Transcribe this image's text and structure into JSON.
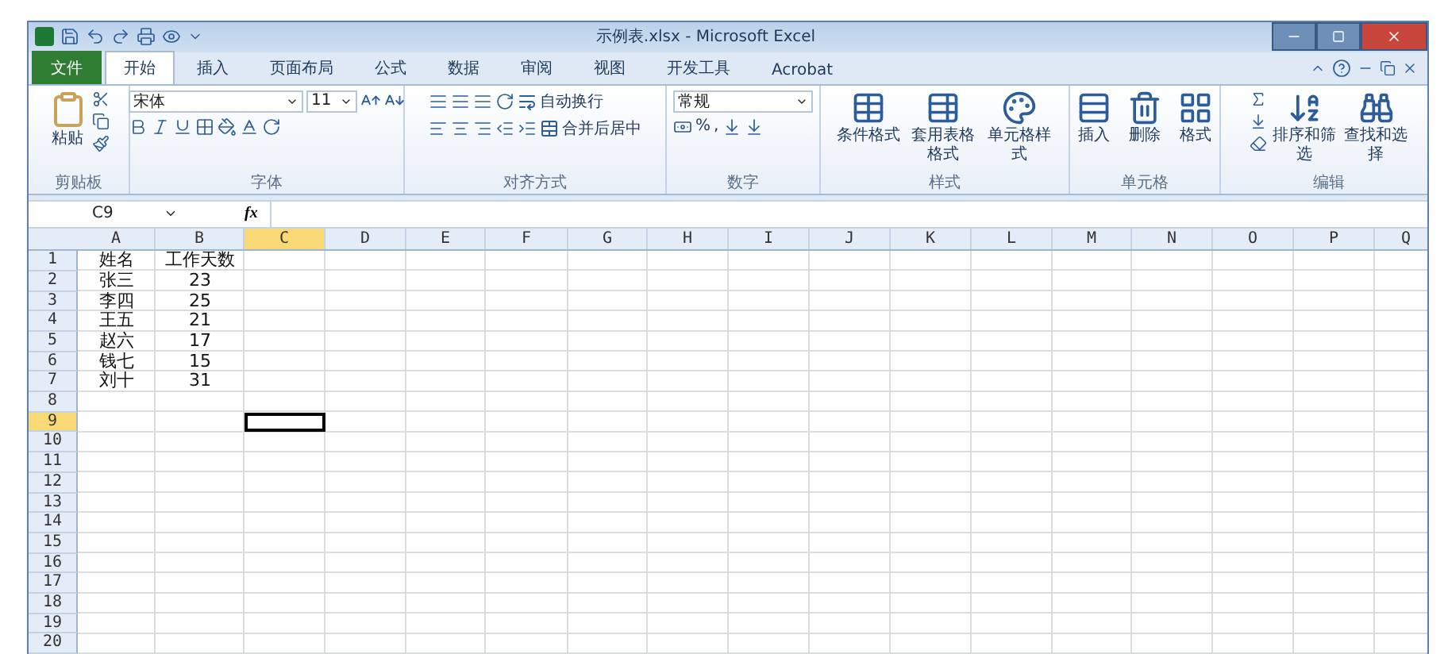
{
  "window": {
    "title": "示例表.xlsx - Microsoft Excel"
  },
  "tabs": [
    {
      "label": "文件",
      "kind": "file",
      "selected": false
    },
    {
      "label": "开始",
      "kind": "tab",
      "selected": true
    },
    {
      "label": "插入",
      "kind": "tab",
      "selected": false
    },
    {
      "label": "页面布局",
      "kind": "tab",
      "selected": false
    },
    {
      "label": "公式",
      "kind": "tab",
      "selected": false
    },
    {
      "label": "数据",
      "kind": "tab",
      "selected": false
    },
    {
      "label": "审阅",
      "kind": "tab",
      "selected": false
    },
    {
      "label": "视图",
      "kind": "tab",
      "selected": false
    },
    {
      "label": "开发工具",
      "kind": "tab",
      "selected": false
    },
    {
      "label": "Acrobat",
      "kind": "tab",
      "selected": false
    }
  ],
  "ribbon": {
    "groups": [
      {
        "label": "剪贴板",
        "kind": "clipboard",
        "paste": "粘贴"
      },
      {
        "label": "字体",
        "kind": "font",
        "font": "宋体",
        "size": "11"
      },
      {
        "label": "对齐方式",
        "kind": "align",
        "wrap": "自动换行",
        "merge": "合并后居中"
      },
      {
        "label": "数字",
        "kind": "number",
        "format": "常规",
        "percent": "%",
        "comma": ","
      },
      {
        "label": "样式",
        "kind": "styles",
        "buttons": [
          "条件格式",
          "套用表格格式",
          "单元格样式"
        ]
      },
      {
        "label": "单元格",
        "kind": "cells",
        "buttons": [
          "插入",
          "删除",
          "格式"
        ]
      },
      {
        "label": "编辑",
        "kind": "edit",
        "buttons": [
          "排序和筛选",
          "查找和选择"
        ]
      }
    ]
  },
  "formula_bar": {
    "name_box": "C9",
    "fx": "fx"
  },
  "sheet": {
    "columns": [
      {
        "label": "A",
        "selected": false
      },
      {
        "label": "B",
        "selected": false
      },
      {
        "label": "C",
        "selected": true
      },
      {
        "label": "D",
        "selected": false
      },
      {
        "label": "E",
        "selected": false
      },
      {
        "label": "F",
        "selected": false
      },
      {
        "label": "G",
        "selected": false
      },
      {
        "label": "H",
        "selected": false
      },
      {
        "label": "I",
        "selected": false
      },
      {
        "label": "J",
        "selected": false
      },
      {
        "label": "K",
        "selected": false
      },
      {
        "label": "L",
        "selected": false
      },
      {
        "label": "M",
        "selected": false
      },
      {
        "label": "N",
        "selected": false
      },
      {
        "label": "O",
        "selected": false
      },
      {
        "label": "P",
        "selected": false
      },
      {
        "label": "Q",
        "selected": false
      }
    ],
    "rows": [
      {
        "label": "1",
        "selected": false,
        "cells": [
          "姓名",
          "工作天数"
        ]
      },
      {
        "label": "2",
        "selected": false,
        "cells": [
          "张三",
          "23"
        ]
      },
      {
        "label": "3",
        "selected": false,
        "cells": [
          "李四",
          "25"
        ]
      },
      {
        "label": "4",
        "selected": false,
        "cells": [
          "王五",
          "21"
        ]
      },
      {
        "label": "5",
        "selected": false,
        "cells": [
          "赵六",
          "17"
        ]
      },
      {
        "label": "6",
        "selected": false,
        "cells": [
          "钱七",
          "15"
        ]
      },
      {
        "label": "7",
        "selected": false,
        "cells": [
          "刘十",
          "31"
        ]
      },
      {
        "label": "8",
        "selected": false,
        "cells": []
      },
      {
        "label": "9",
        "selected": true,
        "cells": []
      },
      {
        "label": "10",
        "selected": false,
        "cells": []
      },
      {
        "label": "11",
        "selected": false,
        "cells": []
      },
      {
        "label": "12",
        "selected": false,
        "cells": []
      },
      {
        "label": "13",
        "selected": false,
        "cells": []
      },
      {
        "label": "14",
        "selected": false,
        "cells": []
      },
      {
        "label": "15",
        "selected": false,
        "cells": []
      },
      {
        "label": "16",
        "selected": false,
        "cells": []
      },
      {
        "label": "17",
        "selected": false,
        "cells": []
      },
      {
        "label": "18",
        "selected": false,
        "cells": []
      },
      {
        "label": "19",
        "selected": false,
        "cells": []
      },
      {
        "label": "20",
        "selected": false,
        "cells": []
      }
    ]
  }
}
